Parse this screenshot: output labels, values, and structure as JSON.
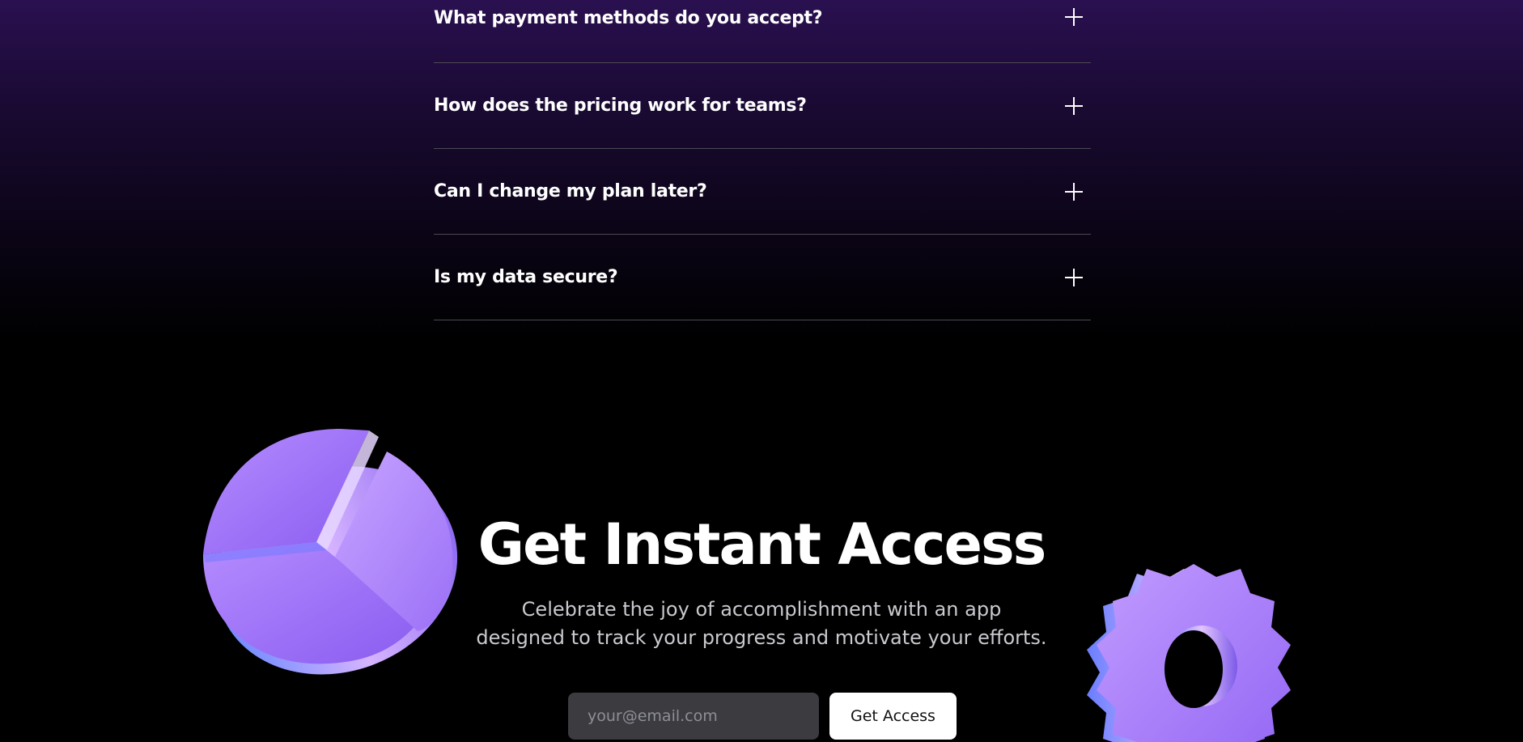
{
  "faq": {
    "items": [
      {
        "question": "What payment methods do you accept?"
      },
      {
        "question": "How does the pricing work for teams?"
      },
      {
        "question": "Can I change my plan later?"
      },
      {
        "question": "Is my data secure?"
      }
    ]
  },
  "cta": {
    "title": "Get Instant Access",
    "subtitle_line1": "Celebrate the joy of accomplishment with an app",
    "subtitle_line2": "designed to track your progress and motivate your efforts.",
    "email_placeholder": "your@email.com",
    "button_label": "Get Access"
  },
  "decorations": {
    "left_icon": "pie-chart-3d-icon",
    "right_icon": "gear-3d-icon",
    "accent_color": "#a07cf5"
  }
}
